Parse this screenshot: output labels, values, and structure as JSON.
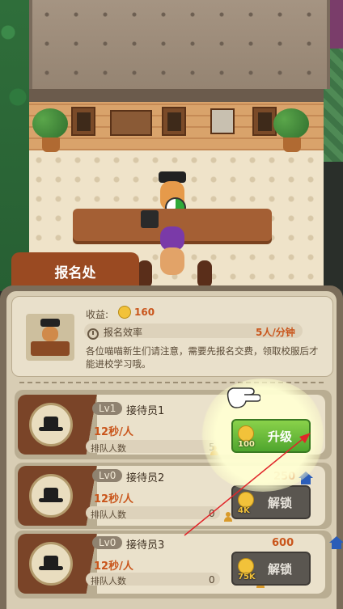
{
  "registration": {
    "title": "报名处",
    "revenue_label": "收益:",
    "revenue_value": "160",
    "efficiency_label": "报名效率",
    "efficiency_value": "5人/分钟",
    "description": "各位喵喵新生们请注意，需要先报名交费，领取校服后才能进校学习哦。"
  },
  "staff": [
    {
      "level": "Lv1",
      "name": "接待员1",
      "speed": "12秒/人",
      "queue_label": "排队人数",
      "queue_count": "5",
      "button_label": "升级",
      "button_cost": "100",
      "unlock_cost": ""
    },
    {
      "level": "Lv0",
      "name": "接待员2",
      "speed": "12秒/人",
      "queue_label": "排队人数",
      "queue_count": "0",
      "button_label": "解锁",
      "button_cost": "4K",
      "unlock_cost": "250"
    },
    {
      "level": "Lv0",
      "name": "接待员3",
      "speed": "12秒/人",
      "queue_label": "排队人数",
      "queue_count": "0",
      "button_label": "解锁",
      "button_cost": "75K",
      "unlock_cost": "600"
    }
  ],
  "colors": {
    "accent_orange": "#c9551b",
    "upgrade_green": "#4fa52e",
    "panel_brown": "#7b6d5a",
    "tab_red": "#9a4a22"
  },
  "icons": [
    "coin-icon",
    "clock-icon",
    "hat-icon",
    "person-icon",
    "house-icon",
    "pointing-hand-icon",
    "arrow-icon"
  ]
}
